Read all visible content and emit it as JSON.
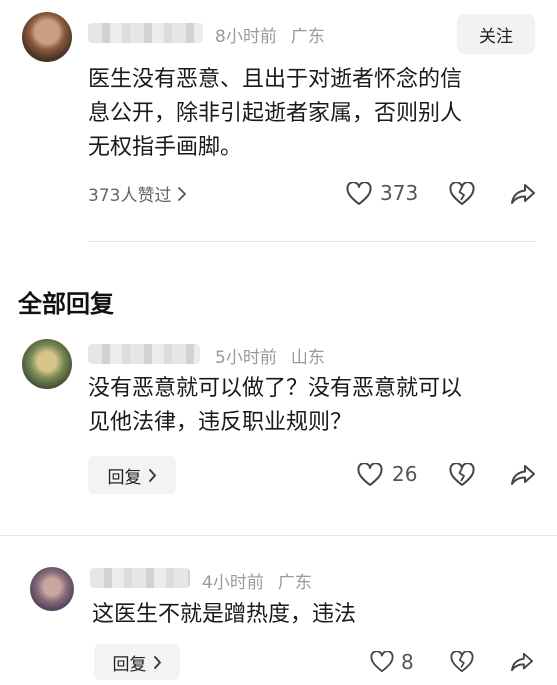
{
  "top_comment": {
    "time": "8小时前",
    "location": "广东",
    "follow_label": "关注",
    "text_lines": [
      "医生没有恶意、且出于对逝者怀念的信",
      "息公开，除非引起逝者家属，否则别人",
      "无权指手画脚。"
    ],
    "likes_summary": "373人赞过",
    "like_count": "373"
  },
  "replies_header": "全部回复",
  "replies": [
    {
      "time": "5小时前",
      "location": "山东",
      "text_lines": [
        "没有恶意就可以做了？没有恶意就可以",
        "见他法律，违反职业规则？"
      ],
      "reply_label": "回复",
      "like_count": "26"
    },
    {
      "time": "4小时前",
      "location": "广东",
      "text_lines": [
        "这医生不就是蹭热度，违法"
      ],
      "reply_label": "回复",
      "like_count": "8"
    }
  ],
  "icons": {
    "heart": "heart-icon",
    "broken_heart": "broken-heart-icon",
    "share": "share-icon",
    "chevron": "chevron-right-icon"
  }
}
